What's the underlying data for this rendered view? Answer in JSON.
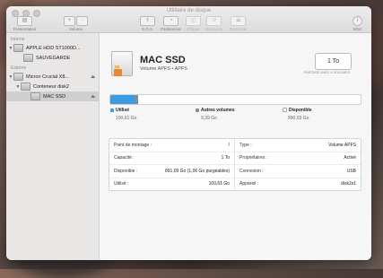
{
  "window": {
    "title": "Utilitaire de disque"
  },
  "toolbar": {
    "presentation_label": "Présentation",
    "volume_label": "Volume",
    "volume_add": "+",
    "volume_remove": "−",
    "buttons": [
      {
        "label": "S.O.S.",
        "icon": "stethoscope-icon"
      },
      {
        "label": "Partitionner",
        "icon": "pie-icon"
      },
      {
        "label": "Effacer",
        "icon": "erase-icon"
      },
      {
        "label": "Restaurer",
        "icon": "restore-icon"
      },
      {
        "label": "Démonter",
        "icon": "unmount-icon"
      }
    ],
    "info_label": "Infos"
  },
  "sidebar": {
    "internal_header": "Interne",
    "external_header": "Externe",
    "items": [
      {
        "label": "APPLE HDD ST1000D..."
      },
      {
        "label": "SAUVEGARDE"
      },
      {
        "label": "Micron Crucial X8..."
      },
      {
        "label": "Conteneur disk2"
      },
      {
        "label": "MAC SSD"
      }
    ],
    "eject_symbol": "⏏"
  },
  "disk": {
    "name": "MAC SSD",
    "subtitle": "Volume APFS • APFS",
    "capacity": "1 To",
    "capacity_note": "PARTAGÉ AVEC 4 VOLUMES"
  },
  "usage": {
    "used_fraction": 0.1006,
    "other_fraction": 0.0094,
    "used_color": "#3d9be2",
    "other_color": "#8c8c8c",
    "free_color": "#ffffff",
    "used_label": "Utilisé",
    "used_value": "100,61 Go",
    "other_label": "Autres volumes",
    "other_value": "9,39 Go",
    "free_label": "Disponible",
    "free_value": "890,03 Go"
  },
  "info": {
    "mount_point_label": "Point de montage :",
    "mount_point_value": "/",
    "type_label": "Type :",
    "type_value": "Volume APFS",
    "capacity_label": "Capacité :",
    "capacity_value": "1 To",
    "owners_label": "Propriétaires :",
    "owners_value": "Activé",
    "available_label": "Disponible :",
    "available_value": "891,09 Go (1,06 Go purgeables)",
    "connection_label": "Connexion :",
    "connection_value": "USB",
    "used_label": "Utilisé :",
    "used_value": "100,61 Go",
    "device_label": "Appareil :",
    "device_value": "disk2s1"
  }
}
